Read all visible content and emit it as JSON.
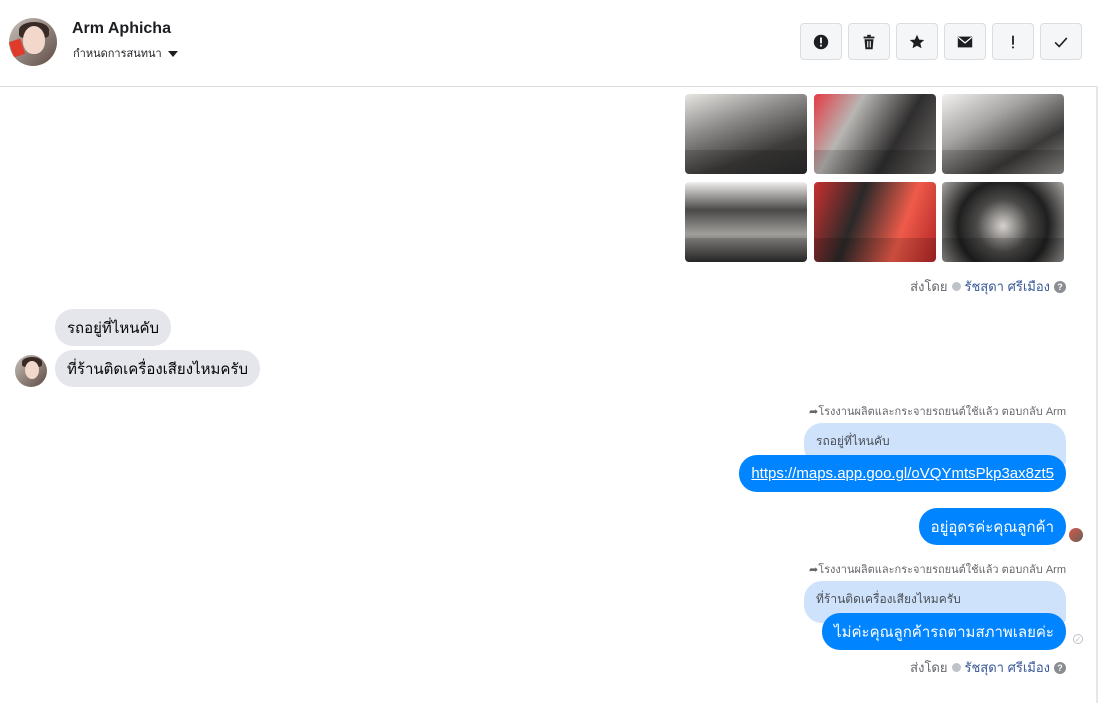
{
  "header": {
    "name": "Arm Aphicha",
    "assign_label": "กำหนดการสนทนา",
    "tools": [
      {
        "icon": "alert-circle-icon"
      },
      {
        "icon": "trash-icon"
      },
      {
        "icon": "star-icon"
      },
      {
        "icon": "envelope-icon"
      },
      {
        "icon": "exclamation-icon"
      },
      {
        "icon": "check-icon"
      }
    ]
  },
  "photos": {
    "count": 6
  },
  "sent_by": {
    "prefix": "ส่งโดย",
    "name": "รัชสุดา ศรีเมือง",
    "help": "?"
  },
  "incoming": [
    {
      "text": "รถอยู่ที่ไหนคับ"
    },
    {
      "text": "ที่ร้านติดเครื่องเสียงไหมครับ"
    }
  ],
  "outgoing": [
    {
      "reply_note": "โรงงานผลิตและกระจายรถยนต์ใช้แล้ว ตอบกลับ Arm",
      "quoted": "รถอยู่ที่ไหนคับ",
      "text": "https://maps.app.goo.gl/oVQYmtsPkp3ax8zt5"
    },
    {
      "text": "อยู่อุดรค่ะคุณลูกค้า"
    },
    {
      "reply_note": "โรงงานผลิตและกระจายรถยนต์ใช้แล้ว ตอบกลับ Arm",
      "quoted": "ที่ร้านติดเครื่องเสียงไหมครับ",
      "text": "ไม่ค่ะคุณลูกค้ารถตามสภาพเลยค่ะ"
    }
  ],
  "colors": {
    "accent": "#0084ff",
    "quoted_bg": "#cfe2fb",
    "incoming_bg": "#e4e6eb"
  }
}
